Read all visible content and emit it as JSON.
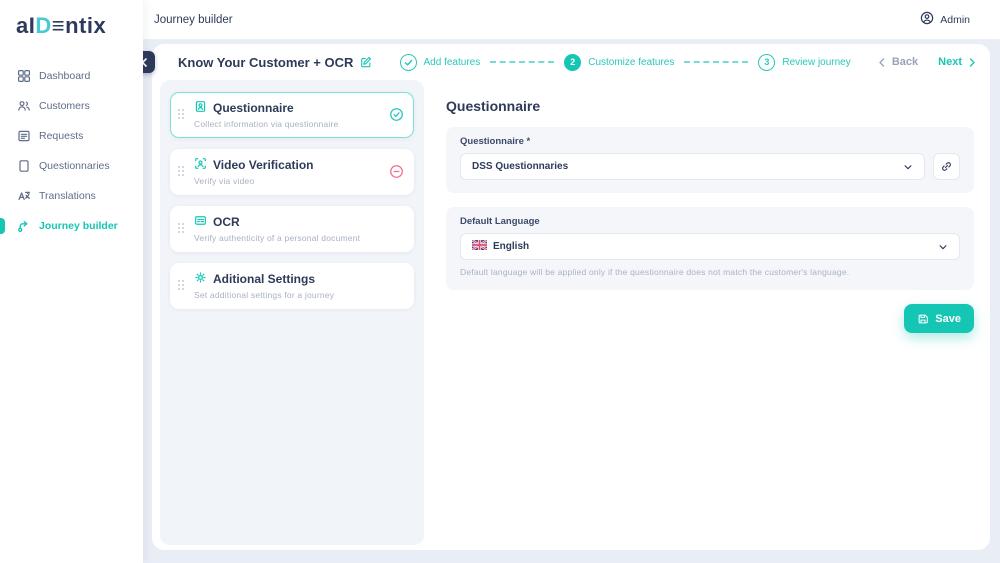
{
  "logo": {
    "part1": "a",
    "part2": "I",
    "part3": "D",
    "part4": "≡",
    "part5": "ntix"
  },
  "topbar": {
    "title": "Journey builder",
    "user_label": "Admin"
  },
  "sidebar": {
    "items": [
      {
        "label": "Dashboard",
        "icon": "dashboard-icon"
      },
      {
        "label": "Customers",
        "icon": "customers-icon"
      },
      {
        "label": "Requests",
        "icon": "requests-icon"
      },
      {
        "label": "Questionnaries",
        "icon": "questionnaires-icon"
      },
      {
        "label": "Translations",
        "icon": "translations-icon"
      },
      {
        "label": "Journey builder",
        "icon": "journey-builder-icon",
        "active": true
      }
    ]
  },
  "journey": {
    "title": "Know Your Customer + OCR",
    "stepper": [
      {
        "label": "Add features",
        "state": "done"
      },
      {
        "number": "2",
        "label": "Customize features",
        "state": "active"
      },
      {
        "number": "3",
        "label": "Review journey",
        "state": "upcoming"
      }
    ],
    "back_label": "Back",
    "next_label": "Next"
  },
  "features": [
    {
      "title": "Questionnaire",
      "subtitle": "Collect information via questionnaire",
      "status": "included"
    },
    {
      "title": "Video Verification",
      "subtitle": "Verify via video",
      "status": "excluded"
    },
    {
      "title": "OCR",
      "subtitle": "Verify authenticity of a personal document",
      "status": "none"
    },
    {
      "title": "Aditional Settings",
      "subtitle": "Set additional settings for a journey",
      "status": "none"
    }
  ],
  "form": {
    "heading": "Questionnaire",
    "questionnaire_label": "Questionnaire *",
    "questionnaire_value": "DSS Questionnaries",
    "language_label": "Default Language",
    "language_value": "English",
    "language_helper": "Default language will be applied only if the questionnaire does not match the customer's language.",
    "save_label": "Save"
  },
  "colors": {
    "accent": "#16c6b4",
    "navy": "#2e3a59",
    "danger": "#f0718b",
    "page_bg": "#e9edf6"
  }
}
